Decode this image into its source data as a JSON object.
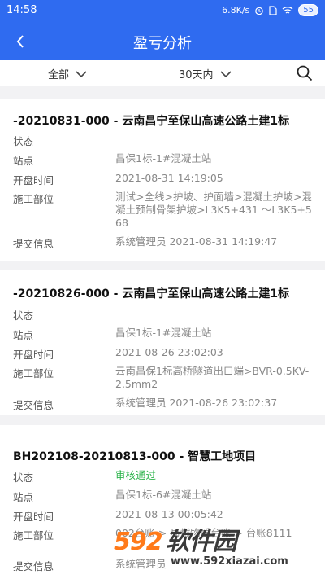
{
  "status_bar": {
    "time": "14:58",
    "speed": "6.8K/s",
    "battery": "55"
  },
  "header": {
    "title": "盈亏分析"
  },
  "filters": {
    "scope": "全部",
    "period": "30天内"
  },
  "labels": {
    "status": "状态",
    "station": "站点",
    "open_time": "开盘时间",
    "construction_part": "施工部位",
    "submit_info": "提交信息"
  },
  "records": [
    {
      "title": "-20210831-000 - 云南昌宁至保山高速公路土建1标",
      "status": "",
      "station": "昌保1标-1#混凝土站",
      "open_time": "2021-08-31 14:19:05",
      "construction_part": "测试>全线>护坡、护面墙>混凝土护坡>混凝土预制骨架护坡>L3K5+431 〜L3K5+568",
      "submit_info": "系统管理员 2021-08-31 14:19:47"
    },
    {
      "title": "-20210826-000 - 云南昌宁至保山高速公路土建1标",
      "status": "",
      "station": "昌保1标-1#混凝土站",
      "open_time": "2021-08-26 23:02:03",
      "construction_part": "云南昌保1标高桥隧道出口端>BVR-0.5KV-2.5mm2",
      "submit_info": "系统管理员 2021-08-26 23:02:37"
    },
    {
      "title": "BH202108-20210813-000 - 智慧工地项目",
      "status": "审核通过",
      "station": "昌保1标-6#混凝土站",
      "open_time": "2021-08-13 00:05:42",
      "construction_part": "002台账 > 易燃物质台账 > 台账8111",
      "submit_info": "系统管理员"
    }
  ],
  "watermark": {
    "logo_a": "592",
    "logo_b": "软件园",
    "url": "www.592xiazai.com"
  },
  "colors": {
    "header_bg": "#2f6bf0",
    "status_approved": "#2bb34a",
    "watermark_orange": "#ff7a1a"
  }
}
